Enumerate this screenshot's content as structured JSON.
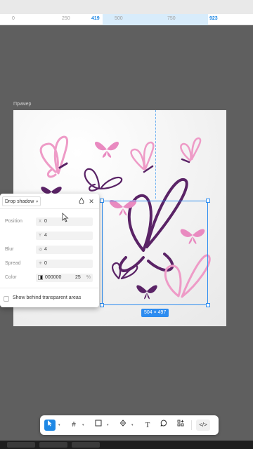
{
  "ruler": {
    "ticks": [
      "0",
      "250",
      "419",
      "500",
      "750",
      "923"
    ]
  },
  "frame": {
    "label": "Пример"
  },
  "selection": {
    "dimensions": "504 × 497"
  },
  "effect_panel": {
    "effect_type": "Drop shadow",
    "position": {
      "label": "Position",
      "x_prefix": "X",
      "x_value": "0",
      "y_prefix": "Y",
      "y_value": "4"
    },
    "blur": {
      "label": "Blur",
      "value": "4"
    },
    "spread": {
      "label": "Spread",
      "value": "0"
    },
    "color": {
      "label": "Color",
      "hex": "000000",
      "opacity": "25",
      "unit": "%"
    },
    "show_behind": {
      "label": "Show behind transparent areas",
      "checked": false
    }
  },
  "toolbar": {
    "tools": [
      "move-tool",
      "frame-tool",
      "shape-tool",
      "pen-tool",
      "text-tool",
      "comment-tool",
      "components-tool",
      "dev-mode-toggle"
    ],
    "active": "move-tool"
  },
  "colors": {
    "light_pink": "#ee9bc7",
    "pink": "#e98ac0",
    "deep_purple": "#5a2366",
    "accent": "#2d8cf0"
  }
}
